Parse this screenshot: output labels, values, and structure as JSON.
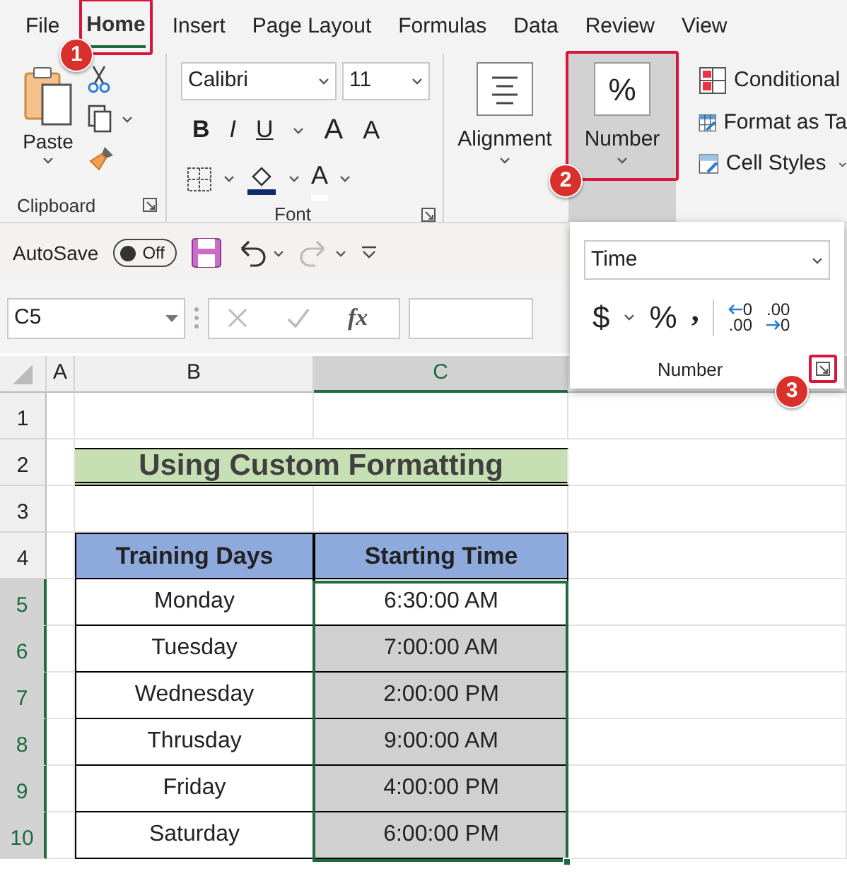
{
  "tabs": [
    {
      "label": "File",
      "selected": false
    },
    {
      "label": "Home",
      "selected": true
    },
    {
      "label": "Insert",
      "selected": false
    },
    {
      "label": "Page Layout",
      "selected": false
    },
    {
      "label": "Formulas",
      "selected": false
    },
    {
      "label": "Data",
      "selected": false
    },
    {
      "label": "Review",
      "selected": false
    },
    {
      "label": "View",
      "selected": false
    }
  ],
  "clipboard": {
    "paste": "Paste",
    "group": "Clipboard"
  },
  "font": {
    "name": "Calibri",
    "size": "11",
    "bold": "B",
    "italic": "I",
    "underline": "U",
    "grow": "A",
    "shrink": "A",
    "font_color": "A",
    "group": "Font"
  },
  "alignment": {
    "label": "Alignment"
  },
  "number": {
    "icon": "%",
    "label": "Number",
    "selected": true
  },
  "styles": [
    "Conditional",
    "Format as Ta",
    "Cell Styles"
  ],
  "quick_access": {
    "autosave": "AutoSave",
    "toggle": "Off",
    "on": false
  },
  "formula_bar": {
    "name_box": "C5",
    "fx": "fx"
  },
  "number_popup": {
    "format": "Time",
    "currency": "$",
    "percent": "%",
    "comma": ",",
    "increase": [
      "0",
      ".00"
    ],
    "decrease": [
      ".00",
      "0"
    ],
    "group": "Number"
  },
  "sheet": {
    "columns": [
      {
        "label": "A",
        "selected": false
      },
      {
        "label": "B",
        "selected": false
      },
      {
        "label": "C",
        "selected": true
      }
    ],
    "rows": [
      {
        "number": "1",
        "kind": "blank"
      },
      {
        "number": "2",
        "kind": "title",
        "text": "Using Custom Formatting"
      },
      {
        "number": "3",
        "kind": "blank"
      },
      {
        "number": "4",
        "kind": "header",
        "cells": [
          "Training Days",
          "Starting Time"
        ]
      },
      {
        "number": "5",
        "kind": "data",
        "cells": [
          "Monday",
          "6:30:00 AM"
        ],
        "selected": true,
        "active": true
      },
      {
        "number": "6",
        "kind": "data",
        "cells": [
          "Tuesday",
          "7:00:00 AM"
        ],
        "selected": true,
        "active": false
      },
      {
        "number": "7",
        "kind": "data",
        "cells": [
          "Wednesday",
          "2:00:00 PM"
        ],
        "selected": true,
        "active": false
      },
      {
        "number": "8",
        "kind": "data",
        "cells": [
          "Thrusday",
          "9:00:00 AM"
        ],
        "selected": true,
        "active": false
      },
      {
        "number": "9",
        "kind": "data",
        "cells": [
          "Friday",
          "4:00:00 PM"
        ],
        "selected": true,
        "active": false
      },
      {
        "number": "10",
        "kind": "data",
        "cells": [
          "Saturday",
          "6:00:00 PM"
        ],
        "selected": true,
        "active": false
      }
    ]
  },
  "steps": [
    "1",
    "2",
    "3"
  ]
}
